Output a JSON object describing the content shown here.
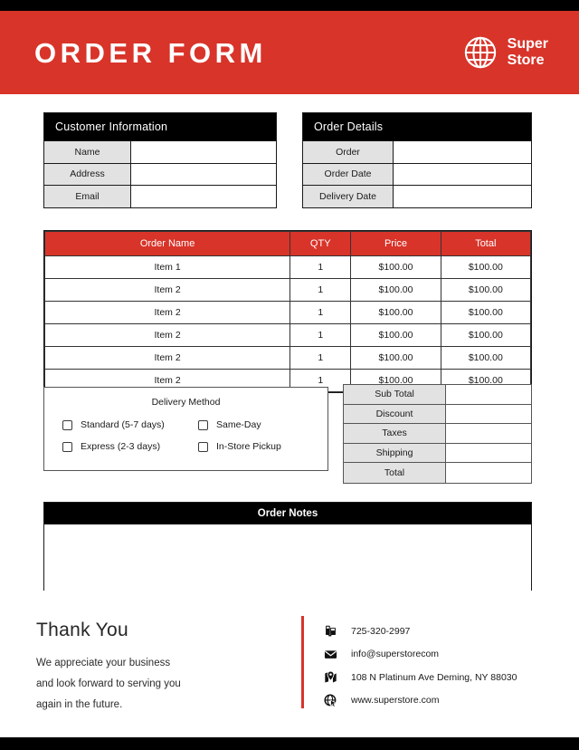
{
  "header": {
    "title": "ORDER FORM",
    "brand_line1": "Super",
    "brand_line2": "Store",
    "accent_color": "#d8342a"
  },
  "customer_information": {
    "heading": "Customer Information",
    "rows": [
      {
        "label": "Name",
        "value": ""
      },
      {
        "label": "Address",
        "value": ""
      },
      {
        "label": "Email",
        "value": ""
      }
    ]
  },
  "order_details": {
    "heading": "Order Details",
    "rows": [
      {
        "label": "Order",
        "value": ""
      },
      {
        "label": "Order Date",
        "value": ""
      },
      {
        "label": "Delivery Date",
        "value": ""
      }
    ]
  },
  "items_table": {
    "columns": [
      "Order Name",
      "QTY",
      "Price",
      "Total"
    ],
    "rows": [
      {
        "name": "Item 1",
        "qty": "1",
        "price": "$100.00",
        "total": "$100.00"
      },
      {
        "name": "Item 2",
        "qty": "1",
        "price": "$100.00",
        "total": "$100.00"
      },
      {
        "name": "Item 2",
        "qty": "1",
        "price": "$100.00",
        "total": "$100.00"
      },
      {
        "name": "Item 2",
        "qty": "1",
        "price": "$100.00",
        "total": "$100.00"
      },
      {
        "name": "Item 2",
        "qty": "1",
        "price": "$100.00",
        "total": "$100.00"
      },
      {
        "name": "Item 2",
        "qty": "1",
        "price": "$100.00",
        "total": "$100.00"
      }
    ]
  },
  "delivery_method": {
    "title": "Delivery Method",
    "options": [
      {
        "label": "Standard (5-7 days)",
        "checked": false
      },
      {
        "label": "Same-Day",
        "checked": false
      },
      {
        "label": "Express (2-3 days)",
        "checked": false
      },
      {
        "label": "In-Store Pickup",
        "checked": false
      }
    ]
  },
  "totals": {
    "rows": [
      {
        "label": "Sub Total",
        "value": ""
      },
      {
        "label": "Discount",
        "value": ""
      },
      {
        "label": "Taxes",
        "value": ""
      },
      {
        "label": "Shipping",
        "value": ""
      },
      {
        "label": "Total",
        "value": ""
      }
    ]
  },
  "order_notes": {
    "heading": "Order Notes",
    "value": ""
  },
  "footer": {
    "thanks_title": "Thank You",
    "message_line1": "We appreciate your business",
    "message_line2": "and look forward to serving you",
    "message_line3": "again in the future.",
    "contacts": [
      {
        "icon": "phone-icon",
        "text": "725-320-2997"
      },
      {
        "icon": "envelope-icon",
        "text": "info@superstorecom"
      },
      {
        "icon": "map-pin-icon",
        "text": "108 N Platinum Ave Deming, NY 88030"
      },
      {
        "icon": "website-icon",
        "text": "www.superstore.com"
      }
    ]
  }
}
